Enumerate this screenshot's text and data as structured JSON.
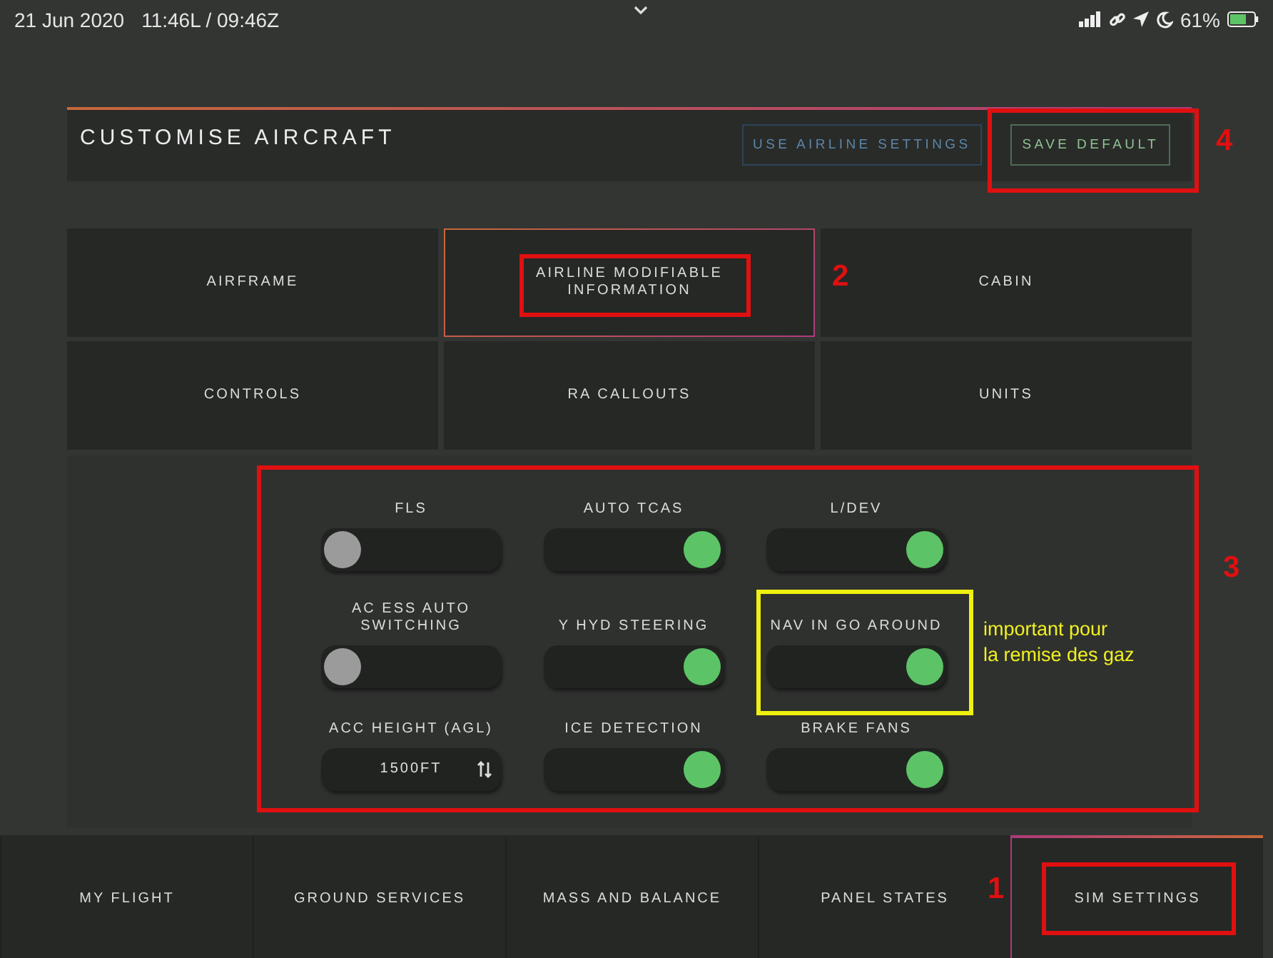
{
  "status_bar": {
    "date": "21 Jun 2020",
    "time": "11:46L / 09:46Z",
    "battery": "61%"
  },
  "header": {
    "title": "CUSTOMISE AIRCRAFT",
    "buttons": [
      {
        "label": "USE AIRLINE SETTINGS",
        "kind": "secondary"
      },
      {
        "label": "SAVE DEFAULT",
        "kind": "primary",
        "annotation": "4"
      }
    ]
  },
  "tabs": [
    {
      "label": "AIRFRAME",
      "selected": false
    },
    {
      "label": "AIRLINE MODIFIABLE INFORMATION",
      "selected": true,
      "annotation": "2"
    },
    {
      "label": "CABIN",
      "selected": false
    },
    {
      "label": "CONTROLS",
      "selected": false
    },
    {
      "label": "RA CALLOUTS",
      "selected": false
    },
    {
      "label": "UNITS",
      "selected": false
    }
  ],
  "settings_annotation": "3",
  "settings": [
    {
      "label": "FLS",
      "kind": "toggle",
      "on": false
    },
    {
      "label": "AUTO TCAS",
      "kind": "toggle",
      "on": true
    },
    {
      "label": "L/DEV",
      "kind": "toggle",
      "on": true
    },
    {
      "label": "AC ESS AUTO SWITCHING",
      "kind": "toggle",
      "on": false
    },
    {
      "label": "Y HYD STEERING",
      "kind": "toggle",
      "on": true
    },
    {
      "label": "NAV IN GO AROUND",
      "kind": "toggle",
      "on": true,
      "note": "important pour\nla remise des gaz"
    },
    {
      "label": "ACC HEIGHT (AGL)",
      "kind": "select",
      "value": "1500FT"
    },
    {
      "label": "ICE DETECTION",
      "kind": "toggle",
      "on": true
    },
    {
      "label": "BRAKE FANS",
      "kind": "toggle",
      "on": true
    }
  ],
  "bottom_nav": [
    {
      "label": "MY FLIGHT",
      "selected": false
    },
    {
      "label": "GROUND SERVICES",
      "selected": false
    },
    {
      "label": "MASS AND BALANCE",
      "selected": false
    },
    {
      "label": "PANEL STATES",
      "selected": false
    },
    {
      "label": "SIM SETTINGS",
      "selected": true,
      "annotation": "1"
    }
  ]
}
